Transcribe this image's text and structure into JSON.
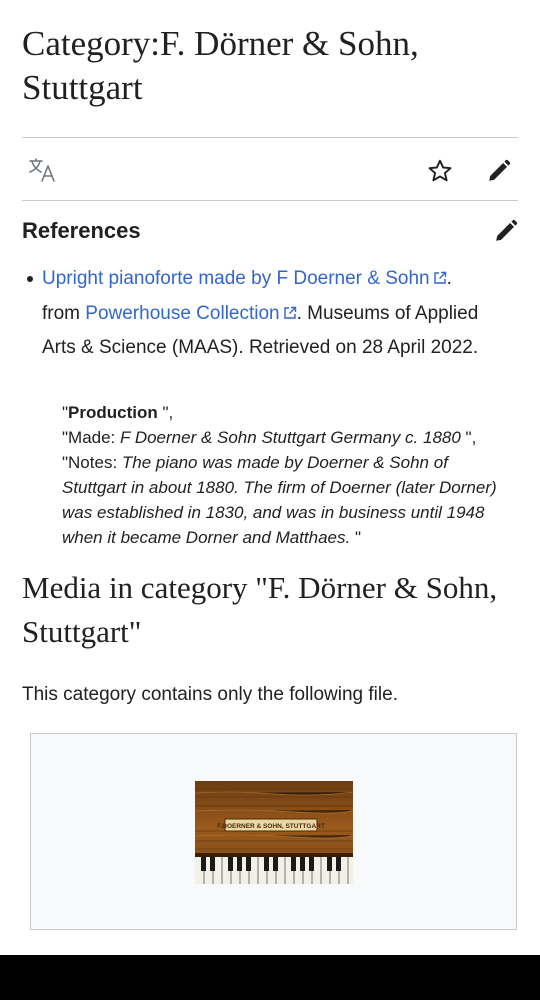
{
  "page": {
    "title": "Category:F. Dörner & Sohn, Stuttgart"
  },
  "toolbar": {
    "language_icon": "translate-icon",
    "watch_icon": "star-icon",
    "edit_icon": "pencil-icon"
  },
  "references": {
    "heading": "References",
    "edit_icon": "pencil-icon",
    "items": [
      {
        "link_text": "Upright pianoforte made by F Doerner & Sohn",
        "after_link": ".",
        "from_text": "from ",
        "source_link": "Powerhouse Collection",
        "rest_text": ". Museums of Applied Arts & Science (MAAS). Retrieved on 28 April 2022."
      }
    ],
    "quote": {
      "line1_bold": "Production",
      "line1_open": "\"",
      "line1_close": " \",",
      "line2_open": "\"Made: ",
      "line2_italic": "F Doerner & Sohn Stuttgart Germany c. 1880",
      "line2_close": " \",",
      "line3_open": "\"Notes: ",
      "line3_italic": "The piano was made by Doerner & Sohn of Stuttgart in about 1880. The firm of Doerner (later Dorner) was established in 1830, and was in business until 1948 when it became Dorner and Matthaes.",
      "line3_close": " \""
    }
  },
  "media": {
    "heading": "Media in category \"F. Dörner & Sohn, Stuttgart\"",
    "description": "This category contains only the following file.",
    "thumbnail_label": "F.DOERNER & SOHN, STUTTGART"
  },
  "colors": {
    "link": "#3366cc",
    "text": "#202122",
    "divider": "#c8ccd1",
    "gallery_bg": "#f8f9fa",
    "bottom_bar": "#000000"
  }
}
